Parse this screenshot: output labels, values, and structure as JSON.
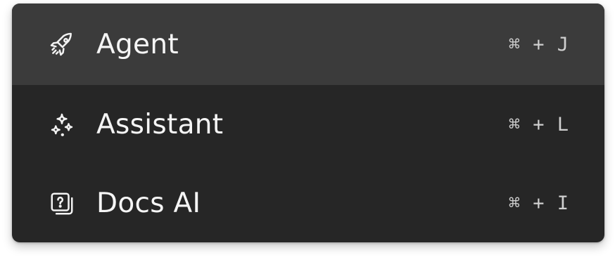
{
  "menu": {
    "items": [
      {
        "label": "Agent",
        "shortcut": "⌘ + J",
        "icon": "rocket-icon",
        "active": true
      },
      {
        "label": "Assistant",
        "shortcut": "⌘ + L",
        "icon": "sparkles-icon",
        "active": false
      },
      {
        "label": "Docs AI",
        "shortcut": "⌘ + I",
        "icon": "docs-question-icon",
        "active": false
      }
    ]
  },
  "colors": {
    "menu_background": "#262626",
    "active_background": "#3b3b3b",
    "text": "#f5f5f5",
    "shortcut_text": "#cfcfcf"
  }
}
